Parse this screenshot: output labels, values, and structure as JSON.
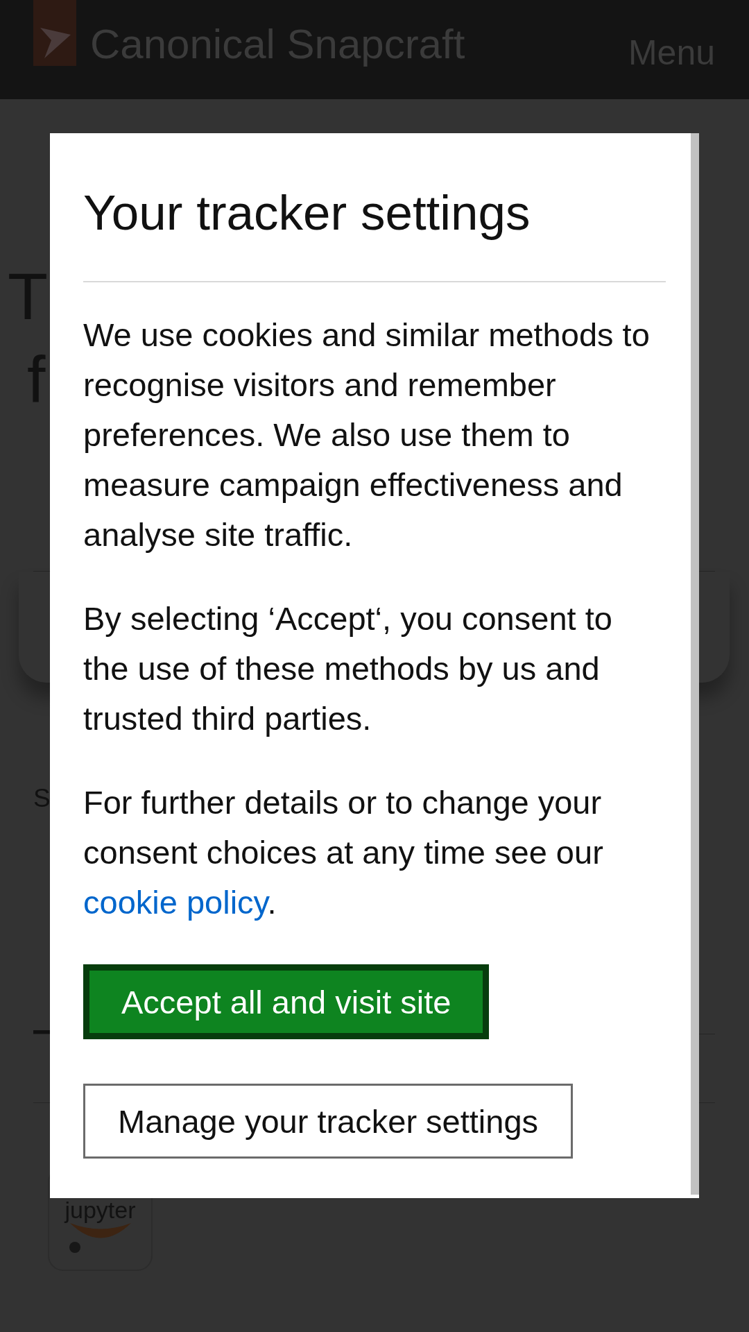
{
  "header": {
    "title": "Canonical Snapcraft",
    "menu": "Menu"
  },
  "page": {
    "heading_lines": [
      "T",
      "f"
    ],
    "section_label": "S",
    "app_icon": {
      "label": "jupyter"
    }
  },
  "dialog": {
    "title": "Your tracker settings",
    "paragraphs": [
      {
        "text": "We use cookies and similar methods to recognise visitors and remember preferences. We also use them to measure campaign effectiveness and analyse site traffic."
      },
      {
        "text": "By selecting ‘Accept‘, you consent to the use of these methods by us and trusted third parties."
      },
      {
        "text": "For further details or to change your consent choices at any time see our",
        "link": "cookie policy",
        "after": "."
      }
    ],
    "buttons": [
      {
        "label": "Accept all and visit site",
        "kind": "primary"
      },
      {
        "label": "Manage your tracker settings",
        "kind": "secondary"
      }
    ]
  }
}
